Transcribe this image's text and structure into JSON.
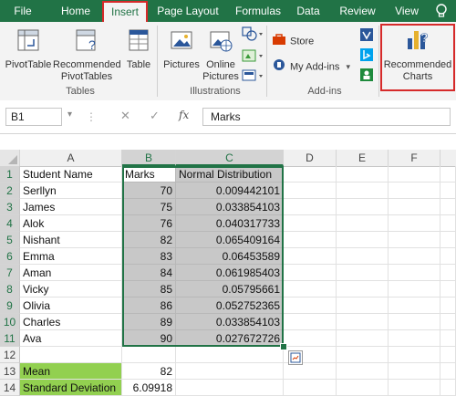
{
  "ribbon_tabs": [
    "File",
    "Home",
    "Insert",
    "Page Layout",
    "Formulas",
    "Data",
    "Review",
    "View"
  ],
  "active_tab": "Insert",
  "ribbon": {
    "groups": {
      "tables": {
        "label": "Tables",
        "pivottable": "PivotTable",
        "recommended_pivot_line1": "Recommended",
        "recommended_pivot_line2": "PivotTables",
        "table": "Table"
      },
      "illustrations": {
        "label": "Illustrations",
        "pictures": "Pictures",
        "online_pictures_line1": "Online",
        "online_pictures_line2": "Pictures"
      },
      "addins": {
        "label": "Add-ins",
        "store": "Store",
        "my_addins": "My Add-ins"
      },
      "charts": {
        "recommended_charts_line1": "Recommended",
        "recommended_charts_line2": "Charts"
      }
    }
  },
  "formula_bar": {
    "name_box": "B1",
    "cancel_symbol": "✕",
    "enter_symbol": "✓",
    "fx_label": "fx",
    "content": "Marks"
  },
  "columns": [
    "A",
    "B",
    "C",
    "D",
    "E",
    "F"
  ],
  "rows": [
    {
      "num": "1",
      "a": "Student Name",
      "b": "Marks",
      "c": "Normal Distribution"
    },
    {
      "num": "2",
      "a": "Serllyn",
      "b": "70",
      "c": "0.009442101"
    },
    {
      "num": "3",
      "a": "James",
      "b": "75",
      "c": "0.033854103"
    },
    {
      "num": "4",
      "a": "Alok",
      "b": "76",
      "c": "0.040317733"
    },
    {
      "num": "5",
      "a": "Nishant",
      "b": "82",
      "c": "0.065409164"
    },
    {
      "num": "6",
      "a": "Emma",
      "b": "83",
      "c": "0.06453589"
    },
    {
      "num": "7",
      "a": "Aman",
      "b": "84",
      "c": "0.061985403"
    },
    {
      "num": "8",
      "a": "Vicky",
      "b": "85",
      "c": "0.05795661"
    },
    {
      "num": "9",
      "a": "Olivia",
      "b": "86",
      "c": "0.052752365"
    },
    {
      "num": "10",
      "a": "Charles",
      "b": "89",
      "c": "0.033854103"
    },
    {
      "num": "11",
      "a": "Ava",
      "b": "90",
      "c": "0.027672726"
    },
    {
      "num": "12",
      "a": "",
      "b": "",
      "c": ""
    },
    {
      "num": "13",
      "a": "Mean",
      "b": "82",
      "c": ""
    },
    {
      "num": "14",
      "a": "Standard Deviation",
      "b": "6.09918",
      "c": ""
    }
  ],
  "colors": {
    "excel_green": "#217346",
    "highlight_red": "#d62a2a",
    "stat_label_green": "#92d050"
  }
}
